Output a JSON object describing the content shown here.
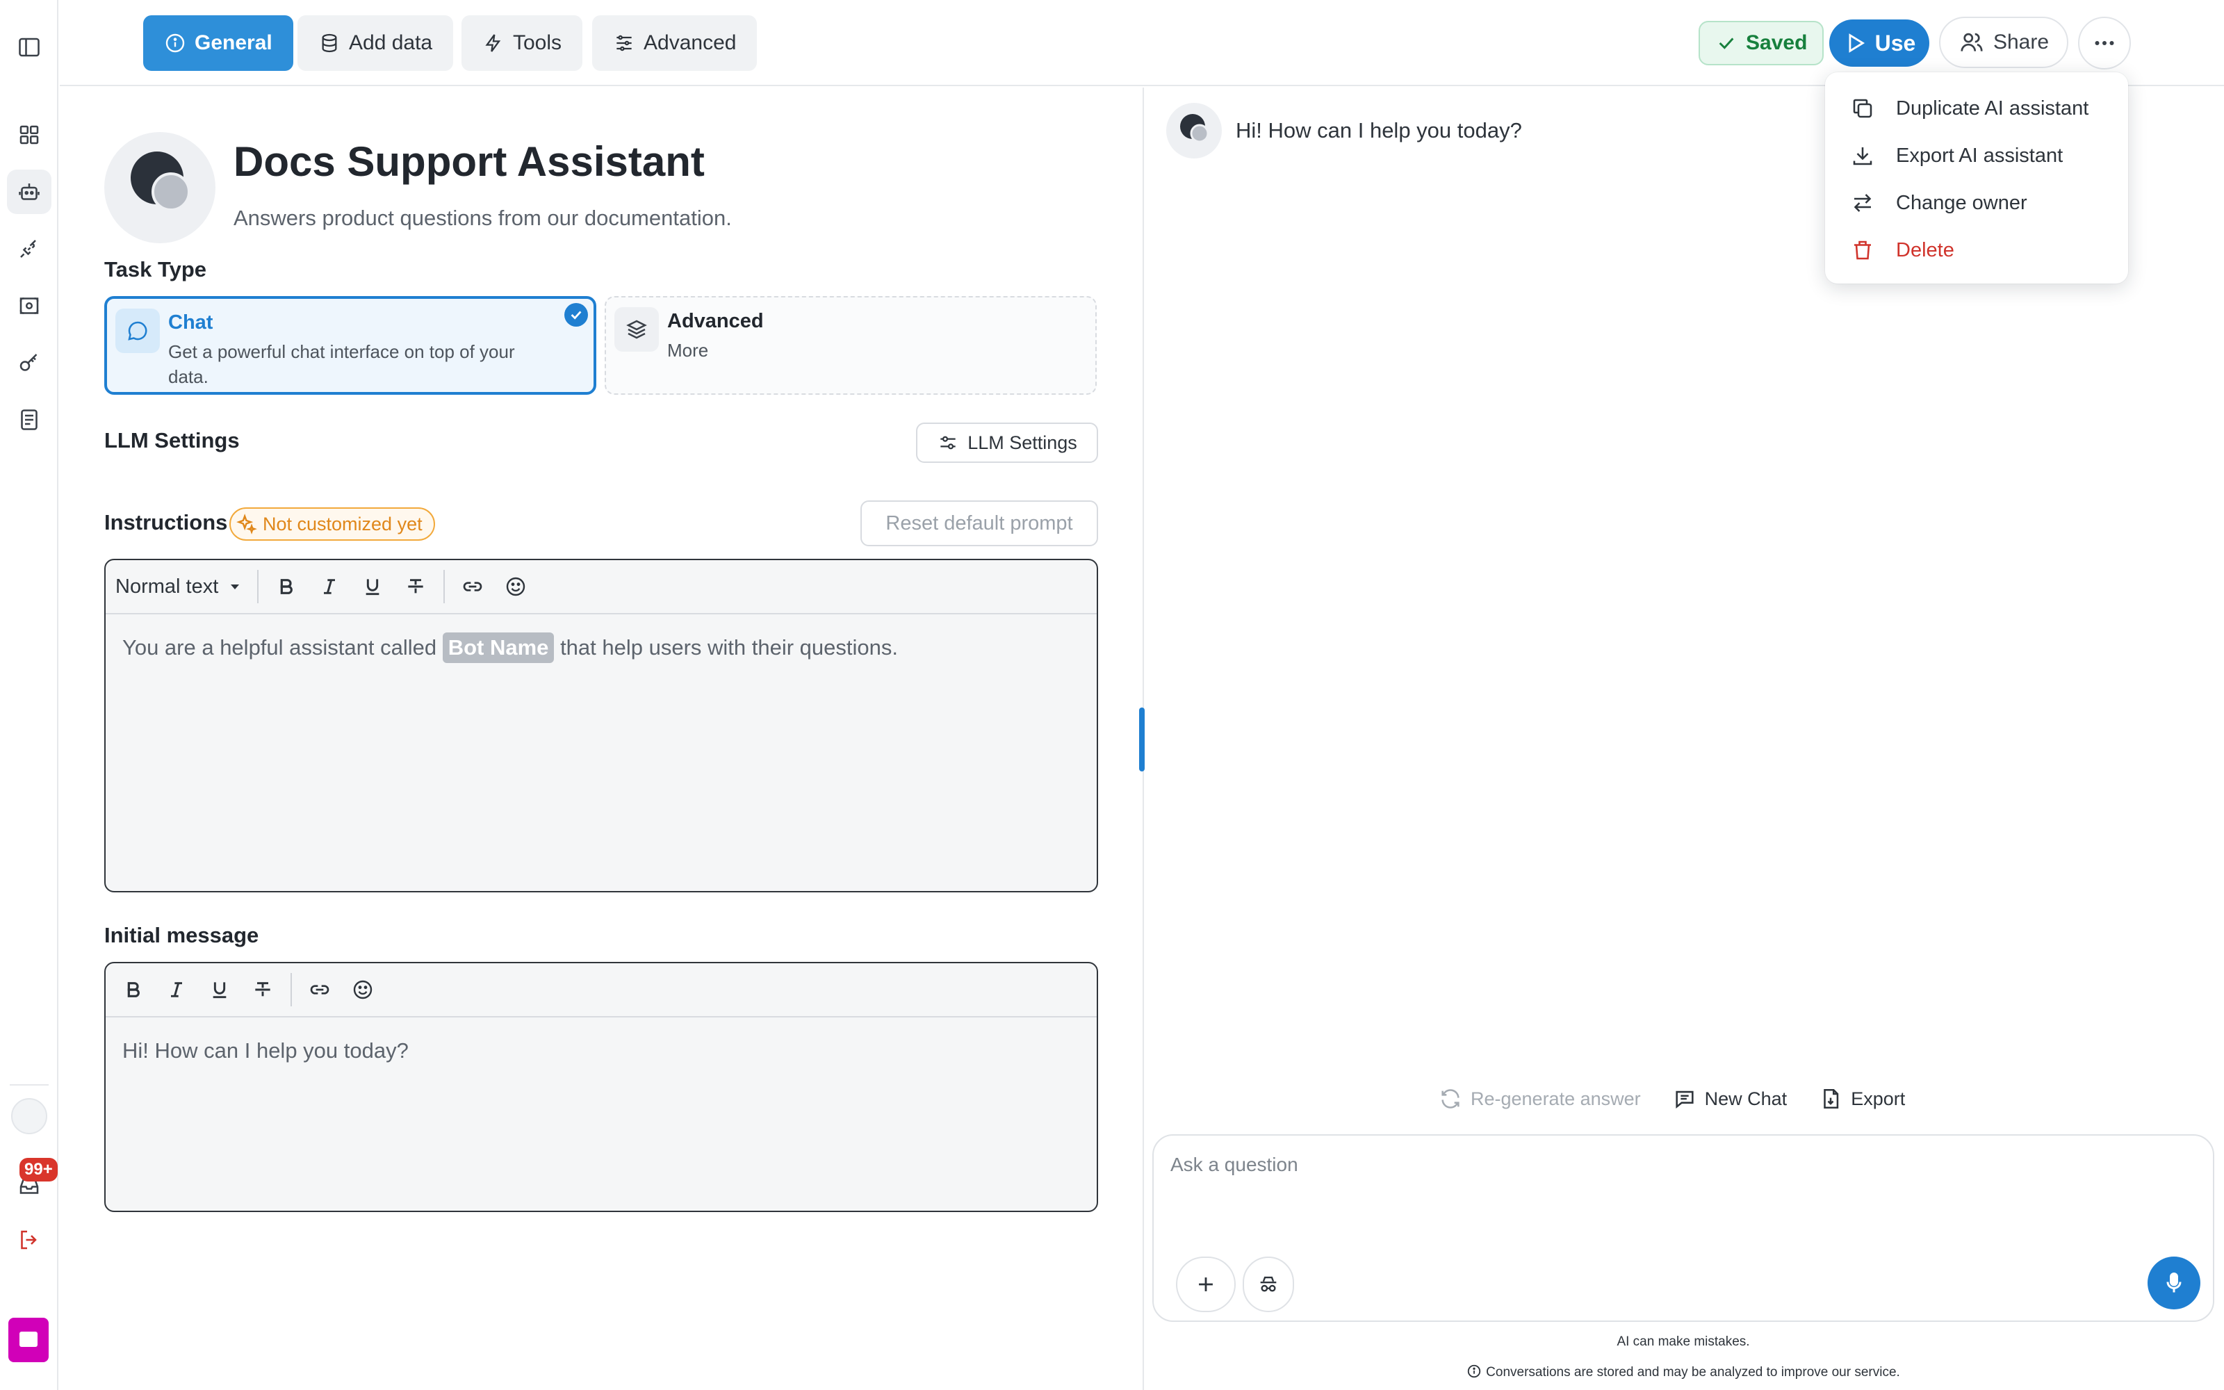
{
  "tabs": [
    {
      "label": "General",
      "icon": "info-circle-icon",
      "active": true
    },
    {
      "label": "Add data",
      "icon": "database-icon",
      "active": false
    },
    {
      "label": "Tools",
      "icon": "lightning-icon",
      "active": false
    },
    {
      "label": "Advanced",
      "icon": "sliders-icon",
      "active": false
    }
  ],
  "header": {
    "saved_label": "Saved",
    "use_label": "Use",
    "share_label": "Share"
  },
  "menu": {
    "items": [
      {
        "label": "Duplicate AI assistant",
        "icon": "copy-icon"
      },
      {
        "label": "Export AI assistant",
        "icon": "download-icon"
      },
      {
        "label": "Change owner",
        "icon": "swap-icon"
      },
      {
        "label": "Delete",
        "icon": "trash-icon",
        "danger": true
      }
    ]
  },
  "sidebar": {
    "notification_count": "99+",
    "icons": [
      "sidebar-toggle-icon",
      "grid-icon",
      "robot-icon",
      "plug-icon",
      "scan-icon",
      "key-icon",
      "book-icon",
      "inbox-icon",
      "logout-icon"
    ]
  },
  "assistant": {
    "name": "Docs Support Assistant",
    "description": "Answers product questions from our documentation."
  },
  "task_type": {
    "label": "Task Type",
    "options": [
      {
        "title": "Chat",
        "subtitle": "Get a powerful chat interface on top of your data.",
        "selected": true
      },
      {
        "title": "Advanced",
        "subtitle": "More",
        "selected": false
      }
    ]
  },
  "llm": {
    "label": "LLM Settings",
    "button_label": "LLM Settings"
  },
  "instructions": {
    "label": "Instructions",
    "status_badge": "Not customized yet",
    "reset_label": "Reset default prompt",
    "format_select": "Normal text",
    "text_before": "You are a helpful assistant called",
    "variable_chip": "Bot Name",
    "text_after": "that help users with their questions."
  },
  "initial_message": {
    "label": "Initial message",
    "text": "Hi! How can I help you today?"
  },
  "chat": {
    "greeting": "Hi! How can I help you today?",
    "regenerate_label": "Re-generate answer",
    "new_chat_label": "New Chat",
    "export_label": "Export",
    "input_placeholder": "Ask a question",
    "disclaimer": "AI can make mistakes.",
    "privacy_note": "Conversations are stored and may be analyzed to improve our service."
  },
  "colors": {
    "accent": "#1f7fd1",
    "saved_green": "#17803d",
    "warning_orange": "#e0871a",
    "danger_red": "#d0332b",
    "badge_red": "#d9352b",
    "app_logo": "#d100b8"
  }
}
